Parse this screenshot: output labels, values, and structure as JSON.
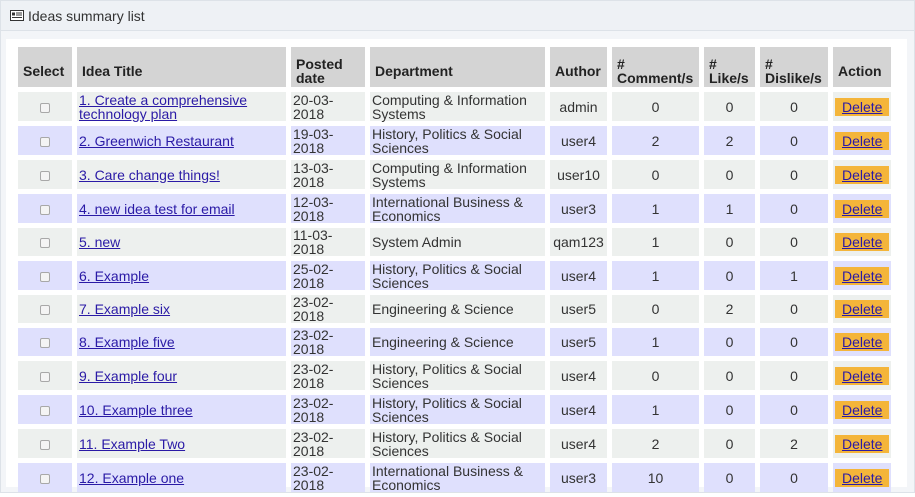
{
  "panel": {
    "title": "Ideas summary list",
    "icon": "list-icon"
  },
  "columns": {
    "select": "Select",
    "title": "Idea Title",
    "posted_line1": "Posted",
    "posted_line2": "date",
    "department": "Department",
    "author": "Author",
    "comments_line1": "#",
    "comments_line2": "Comment/s",
    "likes_line1": "#",
    "likes_line2": "Like/s",
    "dislikes_line1": "#",
    "dislikes_line2": "Dislike/s",
    "action": "Action"
  },
  "rows": [
    {
      "title_line1": "1. Create a comprehensive",
      "title_line2": "technology plan",
      "date": "20-03-2018",
      "dept_line1": "Computing & Information",
      "dept_line2": "Systems",
      "author": "admin",
      "comments": "0",
      "likes": "0",
      "dislikes": "0",
      "action": "Delete"
    },
    {
      "title_line1": "2. Greenwich Restaurant",
      "title_line2": "",
      "date": "19-03-2018",
      "dept_line1": "History, Politics & Social",
      "dept_line2": "Sciences",
      "author": "user4",
      "comments": "2",
      "likes": "2",
      "dislikes": "0",
      "action": "Delete"
    },
    {
      "title_line1": "3. Care change things!",
      "title_line2": "",
      "date": "13-03-2018",
      "dept_line1": "Computing & Information",
      "dept_line2": "Systems",
      "author": "user10",
      "comments": "0",
      "likes": "0",
      "dislikes": "0",
      "action": "Delete"
    },
    {
      "title_line1": "4. new idea test for email",
      "title_line2": "",
      "date": "12-03-2018",
      "dept_line1": "International Business &",
      "dept_line2": "Economics",
      "author": "user3",
      "comments": "1",
      "likes": "1",
      "dislikes": "0",
      "action": "Delete"
    },
    {
      "title_line1": "5. new",
      "title_line2": "",
      "date": "11-03-2018",
      "dept_line1": "System Admin",
      "dept_line2": "",
      "author": "qam123",
      "comments": "1",
      "likes": "0",
      "dislikes": "0",
      "action": "Delete"
    },
    {
      "title_line1": "6. Example",
      "title_line2": "",
      "date": "25-02-2018",
      "dept_line1": "History, Politics & Social",
      "dept_line2": "Sciences",
      "author": "user4",
      "comments": "1",
      "likes": "0",
      "dislikes": "1",
      "action": "Delete"
    },
    {
      "title_line1": "7. Example six",
      "title_line2": "",
      "date": "23-02-2018",
      "dept_line1": "Engineering & Science",
      "dept_line2": "",
      "author": "user5",
      "comments": "0",
      "likes": "2",
      "dislikes": "0",
      "action": "Delete"
    },
    {
      "title_line1": "8. Example five",
      "title_line2": "",
      "date": "23-02-2018",
      "dept_line1": "Engineering & Science",
      "dept_line2": "",
      "author": "user5",
      "comments": "1",
      "likes": "0",
      "dislikes": "0",
      "action": "Delete"
    },
    {
      "title_line1": "9. Example four",
      "title_line2": "",
      "date": "23-02-2018",
      "dept_line1": "History, Politics & Social",
      "dept_line2": "Sciences",
      "author": "user4",
      "comments": "0",
      "likes": "0",
      "dislikes": "0",
      "action": "Delete"
    },
    {
      "title_line1": "10. Example three",
      "title_line2": "",
      "date": "23-02-2018",
      "dept_line1": "History, Politics & Social",
      "dept_line2": "Sciences",
      "author": "user4",
      "comments": "1",
      "likes": "0",
      "dislikes": "0",
      "action": "Delete"
    },
    {
      "title_line1": "11. Example Two",
      "title_line2": "",
      "date": "23-02-2018",
      "dept_line1": "History, Politics & Social",
      "dept_line2": "Sciences",
      "author": "user4",
      "comments": "2",
      "likes": "0",
      "dislikes": "2",
      "action": "Delete"
    },
    {
      "title_line1": "12. Example one",
      "title_line2": "",
      "date": "23-02-2018",
      "dept_line1": "International Business &",
      "dept_line2": "Economics",
      "author": "user3",
      "comments": "10",
      "likes": "0",
      "dislikes": "0",
      "action": "Delete"
    }
  ]
}
